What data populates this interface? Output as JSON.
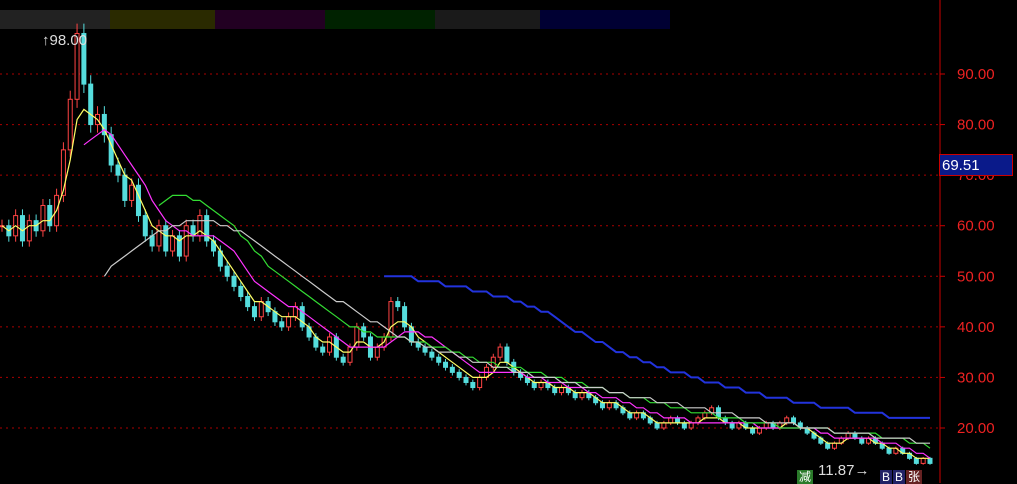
{
  "chart_data": {
    "type": "candlestick",
    "title": "",
    "xlabel": "",
    "ylabel": "",
    "ylim": [
      10,
      100
    ],
    "yticks": [
      20,
      30,
      40,
      50,
      60,
      70,
      80,
      90
    ],
    "ytick_labels": [
      "20.00",
      "30.00",
      "40.00",
      "50.00",
      "60.00",
      "70.00",
      "80.00",
      "90.00"
    ],
    "grid": true,
    "current_price_label": "69.51",
    "high_label": "98.00",
    "low_label": "11.87",
    "price_series": {
      "name": "",
      "values": [
        60,
        58,
        62,
        57,
        61,
        59,
        64,
        60,
        66,
        75,
        85,
        98,
        88,
        80,
        82,
        78,
        72,
        70,
        65,
        68,
        62,
        58,
        56,
        60,
        55,
        58,
        54,
        60,
        58,
        62,
        57,
        55,
        52,
        50,
        48,
        46,
        44,
        42,
        45,
        43,
        41,
        40,
        42,
        44,
        40,
        38,
        36,
        35,
        38,
        34,
        33,
        36,
        40,
        38,
        34,
        36,
        38,
        45,
        44,
        40,
        37,
        36,
        35,
        34,
        33,
        32,
        31,
        30,
        29,
        28,
        30,
        32,
        34,
        36,
        33,
        31,
        30,
        29,
        28,
        29,
        28,
        27,
        28,
        27,
        26,
        27,
        26,
        25,
        24,
        25,
        24,
        23,
        22,
        23,
        22,
        21,
        20,
        21,
        22,
        21,
        20,
        21,
        22,
        23,
        24,
        22,
        21,
        20,
        21,
        20,
        19,
        20,
        21,
        20,
        21,
        22,
        21,
        20,
        19,
        18,
        17,
        16,
        17,
        18,
        19,
        18,
        17,
        18,
        17,
        16,
        15,
        16,
        15,
        14,
        13,
        14,
        13
      ]
    },
    "series": [
      {
        "name": "",
        "color": "#ffff66",
        "values": [
          60,
          59,
          60,
          59,
          60,
          60,
          61,
          61,
          63,
          67,
          73,
          81,
          83,
          82,
          81,
          79,
          76,
          73,
          70,
          69,
          66,
          63,
          60,
          59,
          58,
          58,
          57,
          58,
          58,
          59,
          58,
          57,
          55,
          53,
          51,
          49,
          47,
          45,
          45,
          44,
          43,
          42,
          42,
          42,
          41,
          40,
          38,
          37,
          37,
          36,
          35,
          35,
          37,
          37,
          36,
          36,
          37,
          40,
          41,
          41,
          40,
          38,
          37,
          36,
          35,
          34,
          33,
          32,
          31,
          30,
          30,
          30,
          31,
          33,
          33,
          32,
          31,
          30,
          29,
          29,
          29,
          28,
          28,
          28,
          27,
          27,
          27,
          26,
          25,
          25,
          25,
          24,
          23,
          23,
          23,
          22,
          21,
          21,
          21,
          21,
          21,
          21,
          21,
          22,
          22,
          22,
          21,
          21,
          21,
          20,
          20,
          20,
          20,
          20,
          20,
          21,
          21,
          20,
          20,
          19,
          18,
          17,
          17,
          17,
          18,
          18,
          18,
          18,
          17,
          17,
          16,
          16,
          15,
          15,
          14,
          14,
          14
        ]
      },
      {
        "name": "",
        "color": "#ff33ff",
        "values": [
          null,
          null,
          null,
          null,
          null,
          null,
          null,
          null,
          null,
          null,
          null,
          null,
          76,
          77,
          78,
          79,
          78,
          76,
          74,
          72,
          70,
          68,
          65,
          63,
          61,
          60,
          59,
          59,
          58,
          58,
          58,
          58,
          57,
          56,
          55,
          53,
          51,
          49,
          48,
          47,
          46,
          45,
          44,
          44,
          43,
          42,
          41,
          40,
          39,
          38,
          37,
          36,
          36,
          36,
          36,
          36,
          36,
          37,
          38,
          39,
          39,
          39,
          38,
          38,
          37,
          36,
          35,
          34,
          33,
          32,
          31,
          31,
          31,
          31,
          31,
          31,
          31,
          30,
          30,
          30,
          29,
          29,
          29,
          28,
          28,
          28,
          27,
          27,
          26,
          26,
          26,
          25,
          25,
          24,
          24,
          23,
          23,
          22,
          22,
          22,
          22,
          21,
          21,
          21,
          21,
          21,
          21,
          21,
          21,
          21,
          21,
          20,
          20,
          20,
          20,
          20,
          20,
          20,
          20,
          20,
          19,
          19,
          18,
          18,
          18,
          18,
          18,
          18,
          18,
          17,
          17,
          17,
          16,
          16,
          15,
          15,
          14
        ]
      },
      {
        "name": "",
        "color": "#33dd33",
        "values": [
          null,
          null,
          null,
          null,
          null,
          null,
          null,
          null,
          null,
          null,
          null,
          null,
          null,
          null,
          null,
          null,
          null,
          null,
          null,
          null,
          null,
          null,
          null,
          64,
          65,
          66,
          66,
          66,
          65,
          65,
          64,
          63,
          62,
          61,
          60,
          58,
          57,
          55,
          54,
          52,
          51,
          50,
          49,
          48,
          47,
          46,
          45,
          44,
          43,
          42,
          41,
          40,
          40,
          39,
          39,
          38,
          38,
          38,
          38,
          38,
          37,
          37,
          37,
          36,
          36,
          36,
          35,
          35,
          34,
          34,
          33,
          33,
          33,
          32,
          32,
          32,
          32,
          31,
          31,
          31,
          30,
          30,
          30,
          29,
          29,
          29,
          28,
          28,
          28,
          27,
          27,
          27,
          26,
          26,
          26,
          25,
          25,
          25,
          24,
          24,
          24,
          23,
          23,
          23,
          23,
          22,
          22,
          22,
          22,
          21,
          21,
          21,
          21,
          21,
          20,
          20,
          20,
          20,
          20,
          20,
          20,
          20,
          19,
          19,
          19,
          19,
          19,
          19,
          19,
          18,
          18,
          18,
          18,
          17,
          17,
          17,
          16
        ]
      },
      {
        "name": "",
        "color": "#cccccc",
        "values": [
          null,
          null,
          null,
          null,
          null,
          null,
          null,
          null,
          null,
          null,
          null,
          null,
          null,
          null,
          null,
          50,
          52,
          53,
          54,
          55,
          56,
          57,
          58,
          59,
          59,
          60,
          60,
          61,
          61,
          61,
          61,
          61,
          60,
          60,
          59,
          59,
          58,
          57,
          56,
          55,
          54,
          53,
          52,
          51,
          50,
          49,
          48,
          47,
          46,
          45,
          45,
          44,
          43,
          42,
          41,
          41,
          40,
          39,
          38,
          38,
          37,
          37,
          36,
          36,
          35,
          35,
          35,
          34,
          34,
          33,
          33,
          33,
          32,
          32,
          32,
          31,
          31,
          31,
          30,
          30,
          30,
          30,
          29,
          29,
          29,
          28,
          28,
          28,
          28,
          27,
          27,
          27,
          26,
          26,
          26,
          26,
          25,
          25,
          25,
          25,
          24,
          24,
          24,
          24,
          23,
          23,
          23,
          23,
          22,
          22,
          22,
          22,
          21,
          21,
          21,
          21,
          21,
          20,
          20,
          20,
          20,
          20,
          19,
          19,
          19,
          19,
          19,
          19,
          18,
          18,
          18,
          18,
          18,
          18,
          17,
          17,
          17
        ]
      },
      {
        "name": "",
        "color": "#2233dd",
        "values": [
          null,
          null,
          null,
          null,
          null,
          null,
          null,
          null,
          null,
          null,
          null,
          null,
          null,
          null,
          null,
          null,
          null,
          null,
          null,
          null,
          null,
          null,
          null,
          null,
          null,
          null,
          null,
          null,
          null,
          null,
          null,
          null,
          null,
          null,
          null,
          null,
          null,
          null,
          null,
          null,
          null,
          null,
          null,
          null,
          null,
          null,
          null,
          null,
          null,
          null,
          null,
          null,
          null,
          null,
          null,
          null,
          50,
          50,
          50,
          50,
          50,
          49,
          49,
          49,
          49,
          48,
          48,
          48,
          48,
          47,
          47,
          47,
          46,
          46,
          46,
          45,
          45,
          44,
          44,
          43,
          43,
          42,
          41,
          40,
          39,
          39,
          38,
          37,
          37,
          36,
          35,
          35,
          34,
          34,
          33,
          33,
          32,
          32,
          31,
          31,
          31,
          30,
          30,
          29,
          29,
          29,
          28,
          28,
          28,
          27,
          27,
          27,
          26,
          26,
          26,
          26,
          25,
          25,
          25,
          25,
          24,
          24,
          24,
          24,
          24,
          23,
          23,
          23,
          23,
          23,
          22,
          22,
          22,
          22,
          22,
          22,
          22
        ]
      }
    ]
  },
  "tags": {
    "tag_a": "减",
    "tag_b": "B",
    "tag_c": "B",
    "tag_d": "张"
  },
  "colors": {
    "grid": "#aa0000",
    "axis": "#cc0000",
    "up": "#ff4444",
    "down": "#55dddd"
  }
}
